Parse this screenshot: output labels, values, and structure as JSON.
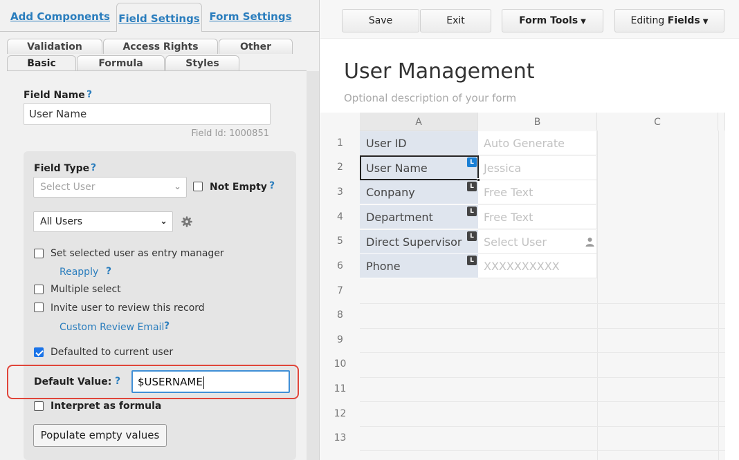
{
  "left_panel": {
    "main_tabs": [
      "Add Components",
      "Field Settings",
      "Form Settings"
    ],
    "sub_tabs": [
      "Validation",
      "Access Rights",
      "Other",
      "Basic",
      "Formula",
      "Styles"
    ],
    "field_name_label": "Field Name",
    "help_mark": "?",
    "field_name_value": "User Name",
    "field_id": "Field Id: 1000851",
    "field_type_label": "Field Type",
    "field_type_value": "Select User",
    "not_empty_label": "Not Empty",
    "users_scope_value": "All Users",
    "set_entry_manager_label": "Set selected user as entry manager",
    "reapply_link": "Reapply",
    "multiple_select_label": "Multiple select",
    "invite_review_label": "Invite user to review this record",
    "custom_review_email_link": "Custom Review Email",
    "defaulted_current_user_label": "Defaulted to current user",
    "default_value_label": "Default Value:",
    "default_value": "$USERNAME",
    "interpret_formula_label": "Interpret as formula",
    "populate_button": "Populate empty values",
    "checks": {
      "not_empty": false,
      "set_entry_manager": false,
      "multiple_select": false,
      "invite_review": false,
      "defaulted_current_user": true,
      "interpret_formula": false
    }
  },
  "toolbar": {
    "save": "Save",
    "exit": "Exit",
    "form_tools": "Form Tools",
    "editing_prefix": "Editing",
    "editing_bold": "Fields"
  },
  "form": {
    "title": "User Management",
    "description": "Optional description of your form"
  },
  "grid": {
    "columns": [
      "A",
      "B",
      "C"
    ],
    "row_numbers": [
      "1",
      "2",
      "3",
      "4",
      "5",
      "6",
      "7",
      "8",
      "9",
      "10",
      "11",
      "12",
      "13"
    ],
    "rows": [
      {
        "label": "User ID",
        "placeholder": "Auto Generate",
        "badge": ""
      },
      {
        "label": "User Name",
        "placeholder": "Jessica",
        "badge": "L"
      },
      {
        "label": "Conpany",
        "placeholder": "Free Text",
        "badge": "L"
      },
      {
        "label": "Department",
        "placeholder": "Free Text",
        "badge": "L"
      },
      {
        "label": "Direct Supervisor",
        "placeholder": "Select User",
        "badge": "L"
      },
      {
        "label": "Phone",
        "placeholder": "XXXXXXXXXX",
        "badge": "L"
      }
    ],
    "selected_row": 2
  },
  "colors": {
    "link_blue": "#2a7dbd",
    "highlight_red": "#e0453a",
    "active_input_border": "#3f8fd6",
    "label_cell_bg": "#dfe5ee",
    "badge_blue": "#1a7fd4",
    "badge_dark": "#444444"
  },
  "icons": [
    "chevron-down-icon",
    "gear-icon",
    "caret-down-icon",
    "person-icon",
    "checkbox-checked-icon"
  ]
}
